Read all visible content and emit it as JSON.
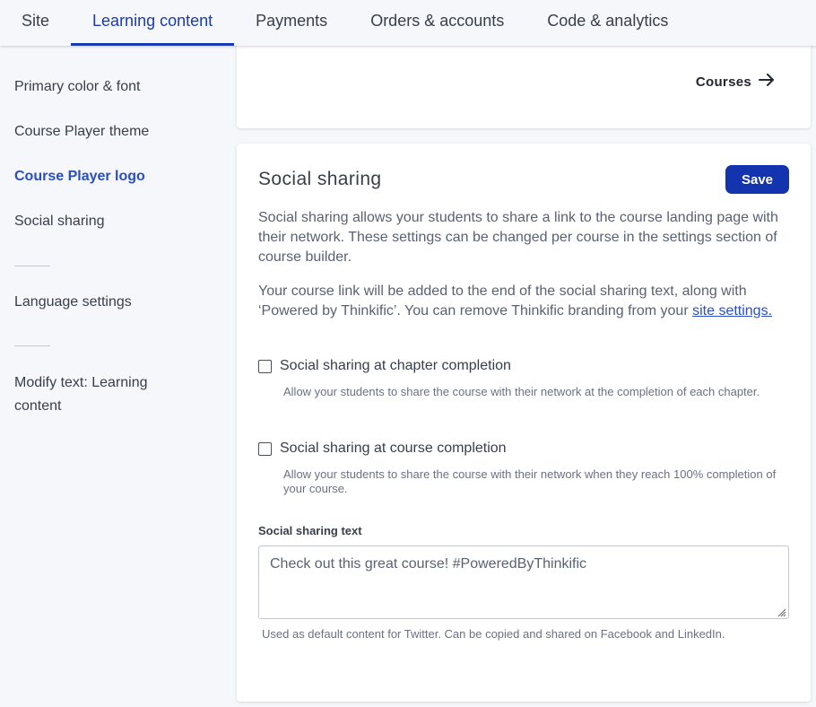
{
  "topnav": {
    "tabs": [
      {
        "label": "Site",
        "active": false
      },
      {
        "label": "Learning content",
        "active": true
      },
      {
        "label": "Payments",
        "active": false
      },
      {
        "label": "Orders & accounts",
        "active": false
      },
      {
        "label": "Code & analytics",
        "active": false
      }
    ]
  },
  "sidebar": {
    "items": [
      {
        "label": "Primary color & font"
      },
      {
        "label": "Course Player theme"
      },
      {
        "label": "Course Player logo",
        "active": true
      },
      {
        "label": "Social sharing"
      },
      {
        "label": "Language settings"
      },
      {
        "label": "Modify text: Learning content"
      }
    ]
  },
  "top_card": {
    "courses_link": "Courses",
    "courses_icon": "arrow-right-icon"
  },
  "social_sharing": {
    "title": "Social sharing",
    "save_label": "Save",
    "description": "Social sharing allows your students to share a link to the course landing page with their network. These settings can be changed per course in the settings section of course builder.",
    "branding_text": "Your course link will be added to the end of the social sharing text, along with ‘Powered by Thinkific’. You can remove Thinkific branding from your ",
    "branding_link": "site settings.",
    "options": [
      {
        "label": "Social sharing at chapter completion",
        "checked": false,
        "help": "Allow your students to share the course with their network at the completion of each chapter."
      },
      {
        "label": "Social sharing at course completion",
        "checked": false,
        "help": "Allow your students to share the course with their network when they reach 100% completion of your course."
      }
    ],
    "text_field": {
      "label": "Social sharing text",
      "value": "Check out this great course! #PoweredByThinkific",
      "help": "Used as default content for Twitter. Can be copied and shared on Facebook and LinkedIn."
    }
  },
  "colors": {
    "accent": "#1a3bb3",
    "save_button": "#1334ae",
    "link": "#2a4ec4"
  }
}
